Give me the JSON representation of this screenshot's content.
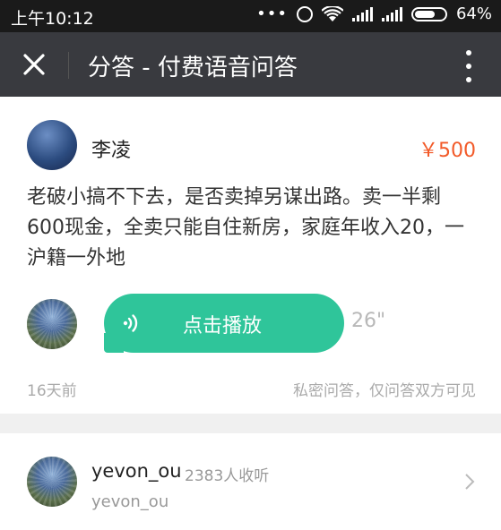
{
  "status_bar": {
    "time": "上午10:12",
    "battery": "64%"
  },
  "app_bar": {
    "title": "分答 - 付费语音问答",
    "close_icon": "close-icon",
    "more_icon": "more-vertical-icon"
  },
  "question": {
    "asker_name": "李凌",
    "price": "￥500",
    "text": "老破小搞不下去，是否卖掉另谋出路。卖一半剩600现金，全卖只能自住新房，家庭年收入20，一沪籍一外地",
    "answer": {
      "button_label": "点击播放",
      "duration": "26\""
    },
    "time_ago": "16天前",
    "privacy_note": "私密问答，仅问答双方可见"
  },
  "answerer": {
    "name": "yevon_ou",
    "listen_count": "2383人收听",
    "subtitle": "yevon_ou"
  },
  "colors": {
    "accent_green": "#2fc59a",
    "price_orange": "#f25a29",
    "app_bar_bg": "#393a3f"
  }
}
